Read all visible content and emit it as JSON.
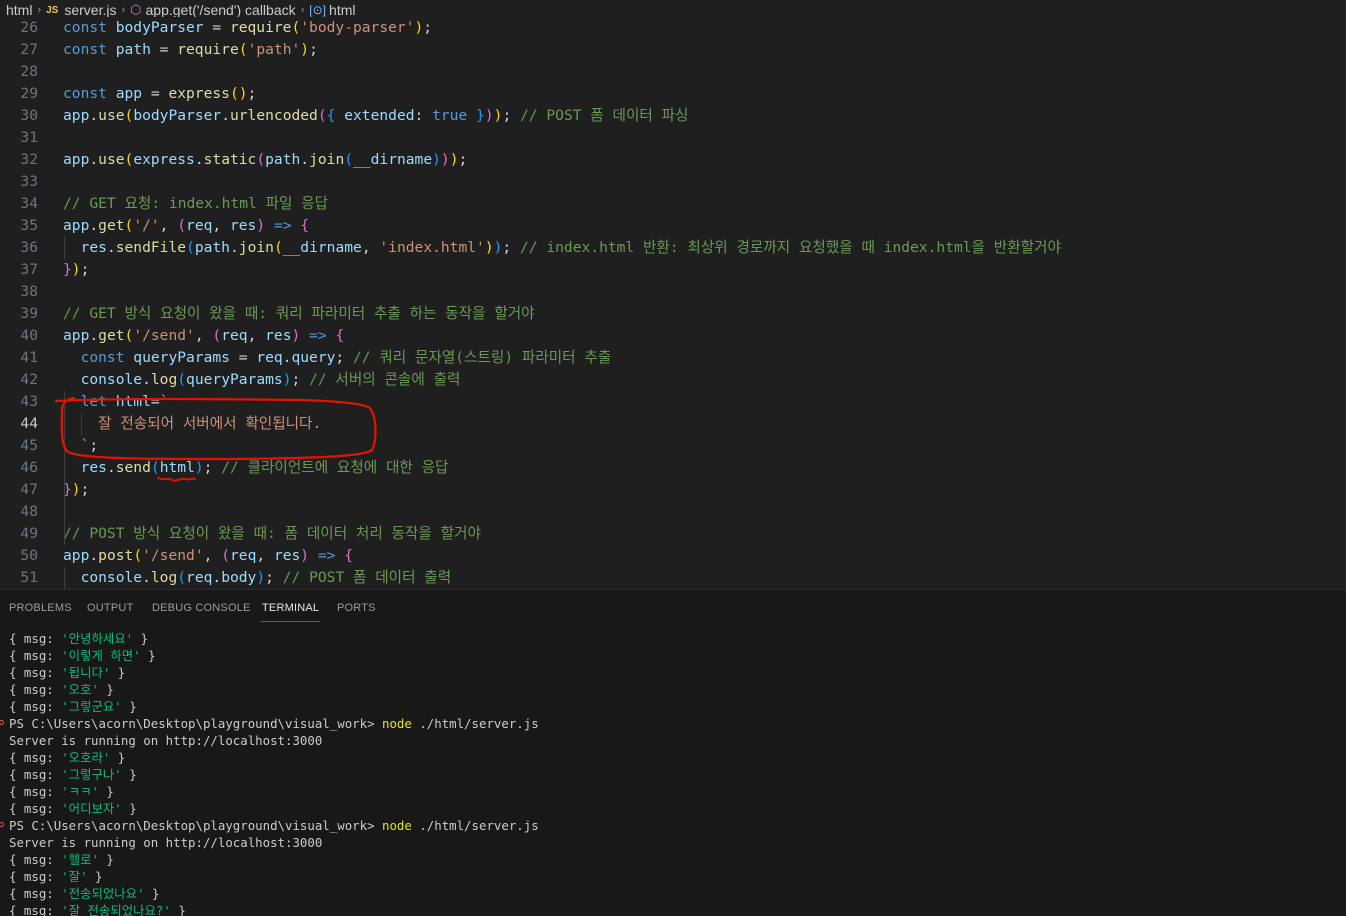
{
  "colors": {
    "keyword": "#569cd6",
    "variable": "#9cdcfe",
    "function": "#dcdcaa",
    "string": "#ce9178",
    "comment": "#6a9955",
    "punct": "#d4d4d4",
    "bracket_gold": "#ffd700",
    "bracket_purple": "#da70d6",
    "bracket_blue": "#179fff",
    "annotation_red": "#e51400"
  },
  "breadcrumb": {
    "items": [
      {
        "icon": "folder",
        "label": "html"
      },
      {
        "icon": "js-file-icon",
        "label": "server.js"
      },
      {
        "icon": "cube-icon",
        "label": "app.get('/send') callback"
      },
      {
        "icon": "variable-icon",
        "label": "html"
      }
    ]
  },
  "editor": {
    "active_line": 44,
    "lines": [
      {
        "n": 26,
        "tokens": [
          [
            "const ",
            "kw"
          ],
          [
            "bodyParser",
            "var"
          ],
          [
            " = ",
            "p"
          ],
          [
            "require",
            "fn"
          ],
          [
            "(",
            "b1"
          ],
          [
            "'body-parser'",
            "str"
          ],
          [
            ")",
            "b1"
          ],
          [
            ";",
            "p"
          ]
        ]
      },
      {
        "n": 27,
        "tokens": [
          [
            "const ",
            "kw"
          ],
          [
            "path",
            "var"
          ],
          [
            " = ",
            "p"
          ],
          [
            "require",
            "fn"
          ],
          [
            "(",
            "b1"
          ],
          [
            "'path'",
            "str"
          ],
          [
            ")",
            "b1"
          ],
          [
            ";",
            "p"
          ]
        ]
      },
      {
        "n": 28,
        "tokens": []
      },
      {
        "n": 29,
        "tokens": [
          [
            "const ",
            "kw"
          ],
          [
            "app",
            "var"
          ],
          [
            " = ",
            "p"
          ],
          [
            "express",
            "fn"
          ],
          [
            "()",
            "b1"
          ],
          [
            ";",
            "p"
          ]
        ]
      },
      {
        "n": 30,
        "tokens": [
          [
            "app",
            "var"
          ],
          [
            ".",
            "p"
          ],
          [
            "use",
            "fn"
          ],
          [
            "(",
            "b1"
          ],
          [
            "bodyParser",
            "var"
          ],
          [
            ".",
            "p"
          ],
          [
            "urlencoded",
            "fn"
          ],
          [
            "(",
            "b2"
          ],
          [
            "{ ",
            "b3"
          ],
          [
            "extended",
            "var"
          ],
          [
            ": ",
            "p"
          ],
          [
            "true",
            "kw"
          ],
          [
            " }",
            "b3"
          ],
          [
            ")",
            "b2"
          ],
          [
            ")",
            "b1"
          ],
          [
            "; ",
            "p"
          ],
          [
            "// POST 폼 데이터 파싱",
            "cm"
          ]
        ]
      },
      {
        "n": 31,
        "tokens": []
      },
      {
        "n": 32,
        "tokens": [
          [
            "app",
            "var"
          ],
          [
            ".",
            "p"
          ],
          [
            "use",
            "fn"
          ],
          [
            "(",
            "b1"
          ],
          [
            "express",
            "var"
          ],
          [
            ".",
            "p"
          ],
          [
            "static",
            "fn"
          ],
          [
            "(",
            "b2"
          ],
          [
            "path",
            "var"
          ],
          [
            ".",
            "p"
          ],
          [
            "join",
            "fn"
          ],
          [
            "(",
            "b3"
          ],
          [
            "__dirname",
            "var"
          ],
          [
            ")",
            "b3"
          ],
          [
            ")",
            "b2"
          ],
          [
            ")",
            "b1"
          ],
          [
            ";",
            "p"
          ]
        ]
      },
      {
        "n": 33,
        "tokens": []
      },
      {
        "n": 34,
        "tokens": [
          [
            "// GET 요청: index.html 파일 응답",
            "cm"
          ]
        ]
      },
      {
        "n": 35,
        "tokens": [
          [
            "app",
            "var"
          ],
          [
            ".",
            "p"
          ],
          [
            "get",
            "fn"
          ],
          [
            "(",
            "b1"
          ],
          [
            "'/'",
            "str"
          ],
          [
            ", ",
            "p"
          ],
          [
            "(",
            "b2"
          ],
          [
            "req",
            "var"
          ],
          [
            ", ",
            "p"
          ],
          [
            "res",
            "var"
          ],
          [
            ")",
            "b2"
          ],
          [
            " ",
            "p"
          ],
          [
            "=>",
            "kw"
          ],
          [
            " ",
            "p"
          ],
          [
            "{",
            "b2"
          ]
        ]
      },
      {
        "n": 36,
        "tokens": [
          [
            "  ",
            "p"
          ],
          [
            "res",
            "var"
          ],
          [
            ".",
            "p"
          ],
          [
            "sendFile",
            "fn"
          ],
          [
            "(",
            "b3"
          ],
          [
            "path",
            "var"
          ],
          [
            ".",
            "p"
          ],
          [
            "join",
            "fn"
          ],
          [
            "(",
            "b1"
          ],
          [
            "__dirname",
            "var"
          ],
          [
            ", ",
            "p"
          ],
          [
            "'index.html'",
            "str"
          ],
          [
            ")",
            "b1"
          ],
          [
            ")",
            "b3"
          ],
          [
            "; ",
            "p"
          ],
          [
            "// index.html 반환: 최상위 경로까지 요청했을 때 index.html을 반환할거야",
            "cm"
          ]
        ]
      },
      {
        "n": 37,
        "tokens": [
          [
            "}",
            "b2"
          ],
          [
            ")",
            "b1"
          ],
          [
            ";",
            "p"
          ]
        ]
      },
      {
        "n": 38,
        "tokens": []
      },
      {
        "n": 39,
        "tokens": [
          [
            "// GET 방식 요청이 왔을 때: 쿼리 파라미터 추출 하는 동작을 할거야",
            "cm"
          ]
        ]
      },
      {
        "n": 40,
        "tokens": [
          [
            "app",
            "var"
          ],
          [
            ".",
            "p"
          ],
          [
            "get",
            "fn"
          ],
          [
            "(",
            "b1"
          ],
          [
            "'/send'",
            "str"
          ],
          [
            ", ",
            "p"
          ],
          [
            "(",
            "b2"
          ],
          [
            "req",
            "var"
          ],
          [
            ", ",
            "p"
          ],
          [
            "res",
            "var"
          ],
          [
            ")",
            "b2"
          ],
          [
            " ",
            "p"
          ],
          [
            "=>",
            "kw"
          ],
          [
            " ",
            "p"
          ],
          [
            "{",
            "b2"
          ]
        ]
      },
      {
        "n": 41,
        "tokens": [
          [
            "  ",
            "p"
          ],
          [
            "const ",
            "kw"
          ],
          [
            "queryParams",
            "var"
          ],
          [
            " = ",
            "p"
          ],
          [
            "req",
            "var"
          ],
          [
            ".",
            "p"
          ],
          [
            "query",
            "var"
          ],
          [
            "; ",
            "p"
          ],
          [
            "// 쿼리 문자열(스트링) 파라미터 추출",
            "cm"
          ]
        ]
      },
      {
        "n": 42,
        "tokens": [
          [
            "  ",
            "p"
          ],
          [
            "console",
            "var"
          ],
          [
            ".",
            "p"
          ],
          [
            "log",
            "fn"
          ],
          [
            "(",
            "b3"
          ],
          [
            "queryParams",
            "var"
          ],
          [
            ")",
            "b3"
          ],
          [
            "; ",
            "p"
          ],
          [
            "// 서버의 콘솔에 출력",
            "cm"
          ]
        ]
      },
      {
        "n": 43,
        "tokens": [
          [
            "  ",
            "p"
          ],
          [
            "let ",
            "kw"
          ],
          [
            "html",
            "var"
          ],
          [
            "=",
            "p"
          ],
          [
            "`",
            "str"
          ]
        ]
      },
      {
        "n": 44,
        "tokens": [
          [
            "    잘 전송되어 서버에서 확인됩니다.",
            "str"
          ]
        ]
      },
      {
        "n": 45,
        "tokens": [
          [
            "  ",
            "p"
          ],
          [
            "`",
            "str"
          ],
          [
            ";",
            "p"
          ]
        ]
      },
      {
        "n": 46,
        "tokens": [
          [
            "  ",
            "p"
          ],
          [
            "res",
            "var"
          ],
          [
            ".",
            "p"
          ],
          [
            "send",
            "fn"
          ],
          [
            "(",
            "b3"
          ],
          [
            "html",
            "var"
          ],
          [
            ")",
            "b3"
          ],
          [
            "; ",
            "p"
          ],
          [
            "// 클라이언트에 요청에 대한 응답",
            "cm"
          ]
        ]
      },
      {
        "n": 47,
        "tokens": [
          [
            "}",
            "b2"
          ],
          [
            ")",
            "b1"
          ],
          [
            ";",
            "p"
          ]
        ]
      },
      {
        "n": 48,
        "tokens": []
      },
      {
        "n": 49,
        "tokens": [
          [
            "// POST 방식 요청이 왔을 때: 폼 데이터 처리 동작을 할거야",
            "cm"
          ]
        ]
      },
      {
        "n": 50,
        "tokens": [
          [
            "app",
            "var"
          ],
          [
            ".",
            "p"
          ],
          [
            "post",
            "fn"
          ],
          [
            "(",
            "b1"
          ],
          [
            "'/send'",
            "str"
          ],
          [
            ", ",
            "p"
          ],
          [
            "(",
            "b2"
          ],
          [
            "req",
            "var"
          ],
          [
            ", ",
            "p"
          ],
          [
            "res",
            "var"
          ],
          [
            ")",
            "b2"
          ],
          [
            " ",
            "p"
          ],
          [
            "=>",
            "kw"
          ],
          [
            " ",
            "p"
          ],
          [
            "{",
            "b2"
          ]
        ]
      },
      {
        "n": 51,
        "tokens": [
          [
            "  ",
            "p"
          ],
          [
            "console",
            "var"
          ],
          [
            ".",
            "p"
          ],
          [
            "log",
            "fn"
          ],
          [
            "(",
            "b3"
          ],
          [
            "req",
            "var"
          ],
          [
            ".",
            "p"
          ],
          [
            "body",
            "var"
          ],
          [
            ")",
            "b3"
          ],
          [
            "; ",
            "p"
          ],
          [
            "// POST 폼 데이터 출력",
            "cm"
          ]
        ]
      }
    ]
  },
  "panel": {
    "tabs": [
      {
        "label": "PROBLEMS",
        "active": false
      },
      {
        "label": "OUTPUT",
        "active": false
      },
      {
        "label": "DEBUG CONSOLE",
        "active": false
      },
      {
        "label": "TERMINAL",
        "active": true
      },
      {
        "label": "PORTS",
        "active": false
      }
    ]
  },
  "terminal": {
    "lines": [
      {
        "type": "msg",
        "value": "'안녕하세요'"
      },
      {
        "type": "msg",
        "value": "'이렇게 하면'"
      },
      {
        "type": "msg",
        "value": "'됩니다'"
      },
      {
        "type": "msg",
        "value": "'오호'"
      },
      {
        "type": "msg",
        "value": "'그렇군요'"
      },
      {
        "type": "prompt",
        "prompt": "PS C:\\Users\\acorn\\Desktop\\playground\\visual_work> ",
        "cmd": "node",
        "args": " ./html/server.js"
      },
      {
        "type": "text",
        "value": "Server is running on http://localhost:3000"
      },
      {
        "type": "msg",
        "value": "'오호라'"
      },
      {
        "type": "msg",
        "value": "'그렇구나'"
      },
      {
        "type": "msg",
        "value": "'ㅋㅋ'"
      },
      {
        "type": "msg",
        "value": "'어디보자'"
      },
      {
        "type": "prompt",
        "prompt": "PS C:\\Users\\acorn\\Desktop\\playground\\visual_work> ",
        "cmd": "node",
        "args": " ./html/server.js"
      },
      {
        "type": "text",
        "value": "Server is running on http://localhost:3000"
      },
      {
        "type": "msg",
        "value": "'헬로'"
      },
      {
        "type": "msg",
        "value": "'잘'"
      },
      {
        "type": "msg",
        "value": "'전송되었나요'"
      },
      {
        "type": "msg",
        "value": "'잘 전송되었나요?'"
      }
    ]
  }
}
